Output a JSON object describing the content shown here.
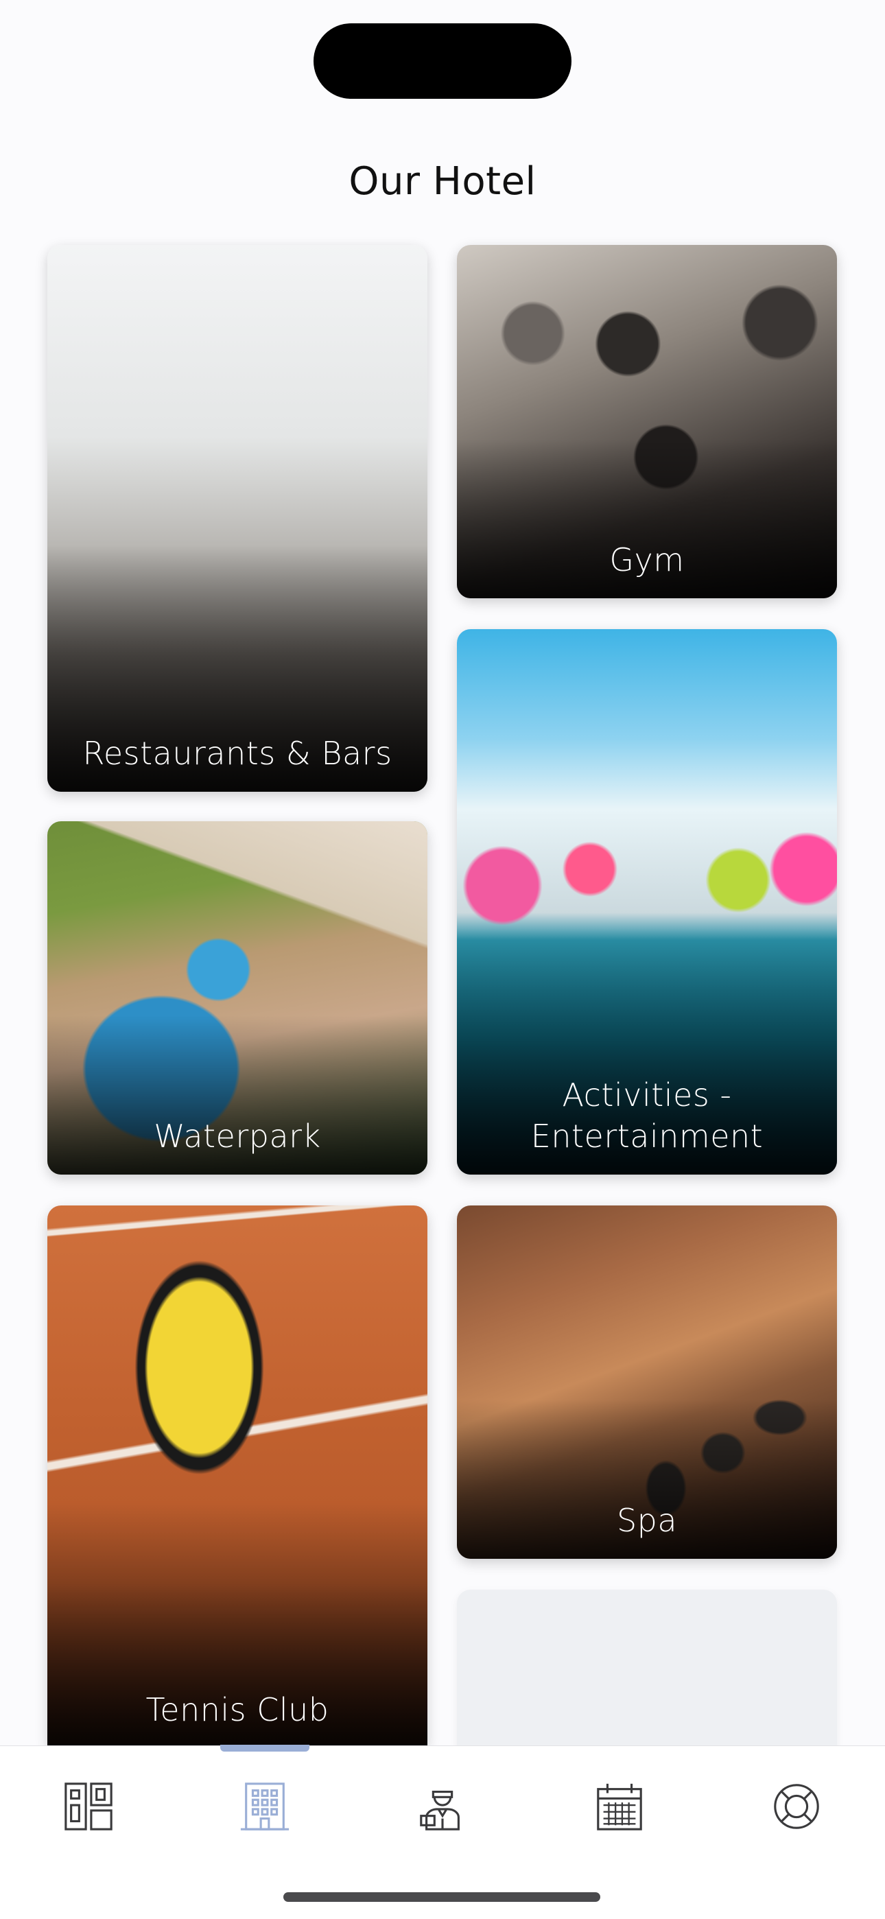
{
  "page": {
    "title": "Our Hotel"
  },
  "tiles": [
    {
      "id": "restaurants",
      "label": "Restaurants & Bars"
    },
    {
      "id": "gym",
      "label": "Gym"
    },
    {
      "id": "waterpark",
      "label": "Waterpark"
    },
    {
      "id": "activities",
      "label": "Activities - Entertainment"
    },
    {
      "id": "tennis",
      "label": "Tennis Club"
    },
    {
      "id": "spa",
      "label": "Spa"
    }
  ],
  "tabbar": {
    "tabs": [
      {
        "icon": "dashboard-icon",
        "active": false
      },
      {
        "icon": "hotel-building-icon",
        "active": true
      },
      {
        "icon": "concierge-staff-icon",
        "active": false
      },
      {
        "icon": "calendar-icon",
        "active": false
      },
      {
        "icon": "lifebuoy-help-icon",
        "active": false
      }
    ],
    "colors": {
      "active": "#9aaed6",
      "inactive": "#3a3a3c"
    }
  }
}
